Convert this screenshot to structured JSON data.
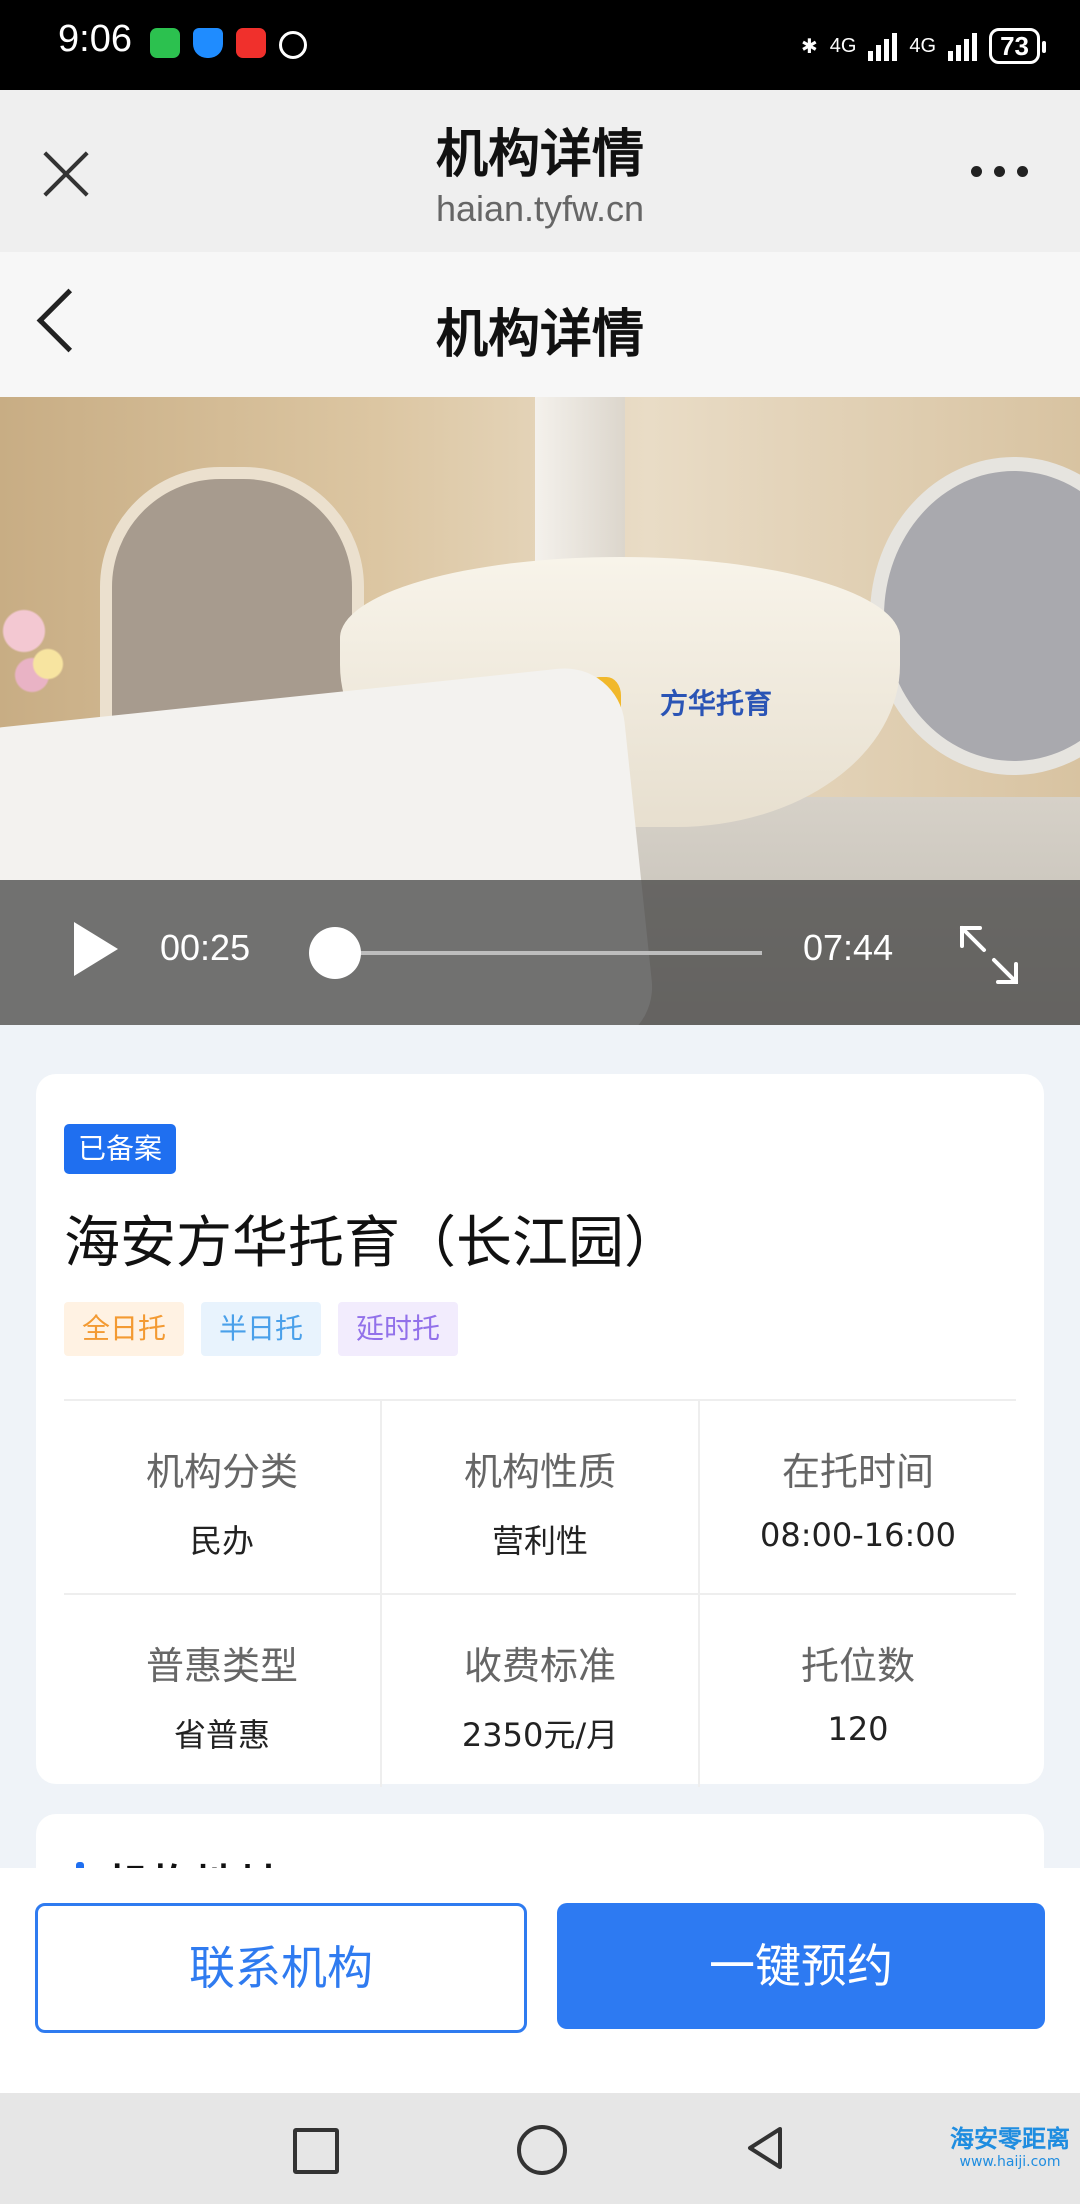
{
  "status_bar": {
    "time": "9:06",
    "battery": "73",
    "network": "4G"
  },
  "browser": {
    "title": "机构详情",
    "url": "haian.tyfw.cn"
  },
  "page": {
    "title": "机构详情"
  },
  "video": {
    "current_time": "00:25",
    "total_time": "07:44",
    "progress": 0.056,
    "logo_text": "方华托育"
  },
  "institution": {
    "badge": "已备案",
    "name": "海安方华托育（长江园）",
    "tags": [
      "全日托",
      "半日托",
      "延时托"
    ],
    "info": [
      {
        "label": "机构分类",
        "value": "民办"
      },
      {
        "label": "机构性质",
        "value": "营利性"
      },
      {
        "label": "在托时间",
        "value": "08:00-16:00"
      },
      {
        "label": "普惠类型",
        "value": "省普惠"
      },
      {
        "label": "收费标准",
        "value": "2350元/月"
      },
      {
        "label": "托位数",
        "value": "120"
      }
    ]
  },
  "next_section": {
    "title": "机构地址"
  },
  "actions": {
    "contact": "联系机构",
    "book": "一键预约"
  },
  "watermark": {
    "name": "海安零距离",
    "url": "www.haiji.com"
  },
  "colors": {
    "primary": "#2d7af2",
    "badge": "#1f6ff0"
  }
}
